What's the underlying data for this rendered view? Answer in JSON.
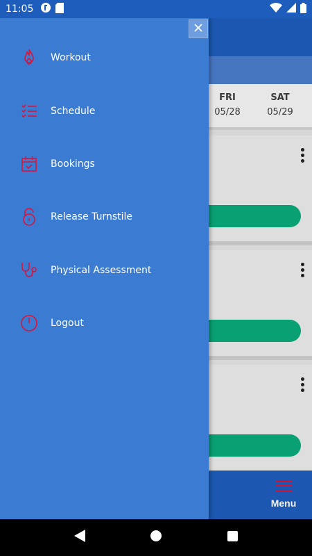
{
  "status_bar": {
    "time": "11:05",
    "icons": [
      "app-notification-icon",
      "sd-card-icon",
      "wifi-icon",
      "signal-icon",
      "battery-icon"
    ]
  },
  "schedule": {
    "days": [
      {
        "name": "FRI",
        "date": "05/28"
      },
      {
        "name": "SAT",
        "date": "05/29"
      }
    ]
  },
  "bottom_nav": {
    "menu_label": "Menu"
  },
  "drawer": {
    "items": [
      {
        "label": "Workout",
        "icon": "flame-icon"
      },
      {
        "label": "Schedule",
        "icon": "checklist-icon"
      },
      {
        "label": "Bookings",
        "icon": "calendar-check-icon"
      },
      {
        "label": "Release Turnstile",
        "icon": "unlock-icon"
      },
      {
        "label": "Physical Assessment",
        "icon": "stethoscope-icon"
      },
      {
        "label": "Logout",
        "icon": "power-icon"
      }
    ]
  },
  "colors": {
    "primary": "#1e5dbb",
    "drawer": "#3b7bd2",
    "accent_red": "#d9143b",
    "action_green": "#0aa97a"
  }
}
